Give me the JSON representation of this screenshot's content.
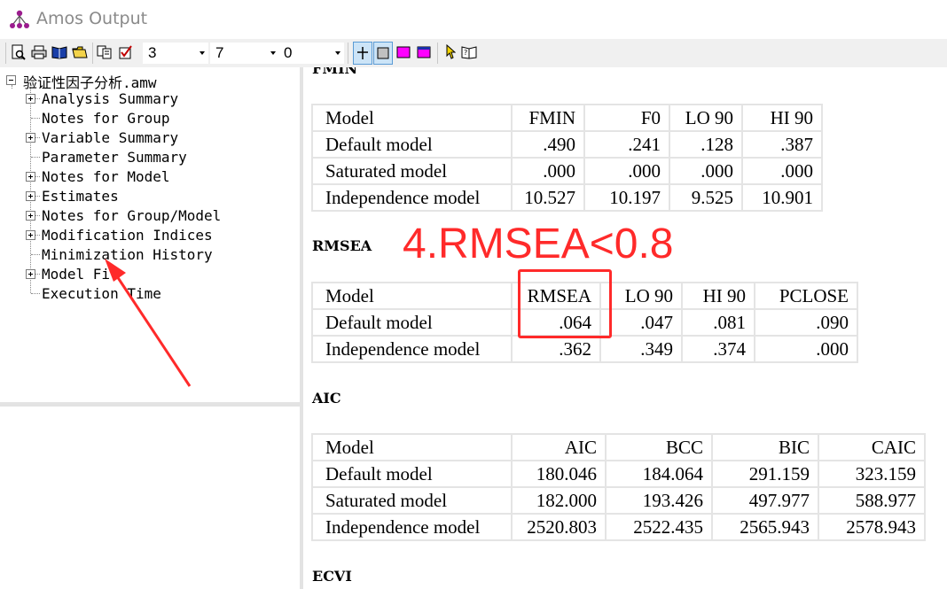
{
  "window": {
    "title": "Amos Output",
    "icon": "amos-path-diagram-icon"
  },
  "toolbar": {
    "icons": [
      "print-preview-icon",
      "print-icon",
      "book-icon",
      "open-folder-icon",
      "copy-icon",
      "checkbox-icon",
      "grid-lines-icon",
      "gray-square-icon",
      "magenta-square-icon",
      "blue-magenta-square-icon",
      "pointer-icon",
      "help-book-icon"
    ],
    "combo1": "3",
    "combo2": "7",
    "combo3": "0"
  },
  "tree": {
    "root": "验证性因子分析.amw",
    "items": [
      {
        "label": "Analysis Summary",
        "expandable": true
      },
      {
        "label": "Notes for Group",
        "expandable": false
      },
      {
        "label": "Variable Summary",
        "expandable": true
      },
      {
        "label": "Parameter Summary",
        "expandable": false
      },
      {
        "label": "Notes for Model",
        "expandable": true
      },
      {
        "label": "Estimates",
        "expandable": true
      },
      {
        "label": "Notes for Group/Model",
        "expandable": true
      },
      {
        "label": "Modification Indices",
        "expandable": true
      },
      {
        "label": "Minimization History",
        "expandable": false
      },
      {
        "label": "Model Fit",
        "expandable": true
      },
      {
        "label": "Execution Time",
        "expandable": false
      }
    ]
  },
  "sections": {
    "fmin": {
      "title": "FMIN",
      "headers": [
        "Model",
        "FMIN",
        "F0",
        "LO 90",
        "HI 90"
      ],
      "rows": [
        [
          "Default model",
          ".490",
          ".241",
          ".128",
          ".387"
        ],
        [
          "Saturated model",
          ".000",
          ".000",
          ".000",
          ".000"
        ],
        [
          "Independence model",
          "10.527",
          "10.197",
          "9.525",
          "10.901"
        ]
      ]
    },
    "rmsea": {
      "title": "RMSEA",
      "headers": [
        "Model",
        "RMSEA",
        "LO 90",
        "HI 90",
        "PCLOSE"
      ],
      "rows": [
        [
          "Default model",
          ".064",
          ".047",
          ".081",
          ".090"
        ],
        [
          "Independence model",
          ".362",
          ".349",
          ".374",
          ".000"
        ]
      ]
    },
    "aic": {
      "title": "AIC",
      "headers": [
        "Model",
        "AIC",
        "BCC",
        "BIC",
        "CAIC"
      ],
      "rows": [
        [
          "Default model",
          "180.046",
          "184.064",
          "291.159",
          "323.159"
        ],
        [
          "Saturated model",
          "182.000",
          "193.426",
          "497.977",
          "588.977"
        ],
        [
          "Independence model",
          "2520.803",
          "2522.435",
          "2565.943",
          "2578.943"
        ]
      ]
    },
    "ecvi": {
      "title": "ECVI"
    }
  },
  "annotation": {
    "text": "4.RMSEA<0.8",
    "color": "#ff2a2a"
  }
}
